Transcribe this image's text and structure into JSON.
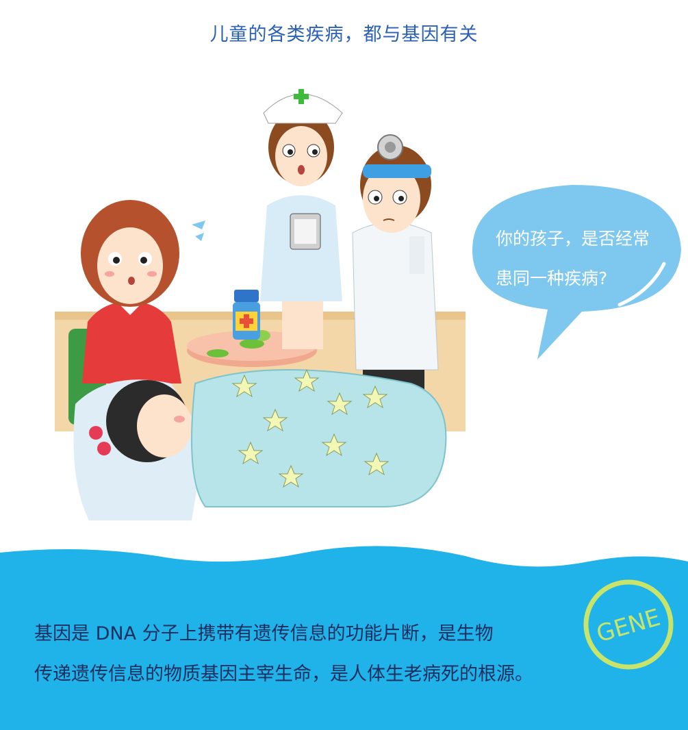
{
  "title": "儿童的各类疾病，都与基因有关",
  "speech_bubble": {
    "line1": "你的孩子，是否经常",
    "line2": "患同一种疾病?"
  },
  "info": {
    "line1": "基因是 DNA 分子上携带有遗传信息的功能片断，是生物",
    "line2": "传递遗传信息的物质基因主宰生命，是人体生老病死的根源。"
  },
  "badge": {
    "label": "GENE"
  },
  "colors": {
    "title": "#2a61b6",
    "bubble": "#7ec8ef",
    "wave": "#1fb3ea",
    "badge": "#c9e46a",
    "info_text": "#1d2f5e"
  }
}
